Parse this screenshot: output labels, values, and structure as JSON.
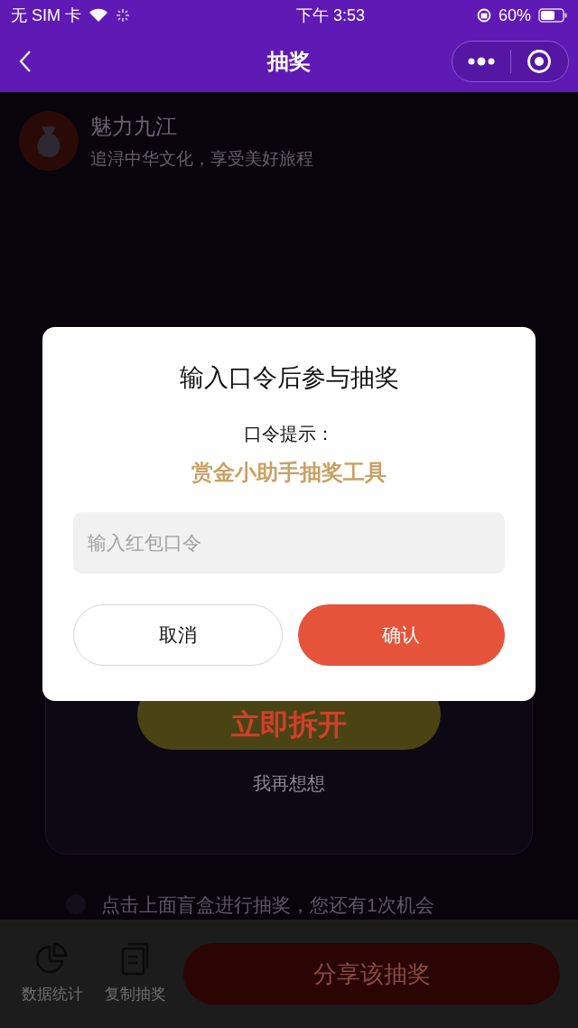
{
  "status_bar": {
    "carrier": "无 SIM 卡",
    "time": "下午 3:53",
    "battery": "60%"
  },
  "nav": {
    "title": "抽奖"
  },
  "header": {
    "title": "魅力九江",
    "subtitle": "追浔中华文化，享受美好旅程"
  },
  "open_button": "立即拆开",
  "think_link": "我再想想",
  "hint": "点击上面盲盒进行抽奖，您还有1次机会",
  "bottom_bar": {
    "actions": [
      {
        "kind": "stats",
        "label": "数据统计"
      },
      {
        "kind": "copy",
        "label": "复制抽奖"
      }
    ],
    "share_button": "分享该抽奖"
  },
  "dialog": {
    "title": "输入口令后参与抽奖",
    "hint_label": "口令提示：",
    "hint_value": "赏金小助手抽奖工具",
    "input": {
      "placeholder": "输入红包口令"
    },
    "cancel": "取消",
    "confirm": "确认"
  }
}
